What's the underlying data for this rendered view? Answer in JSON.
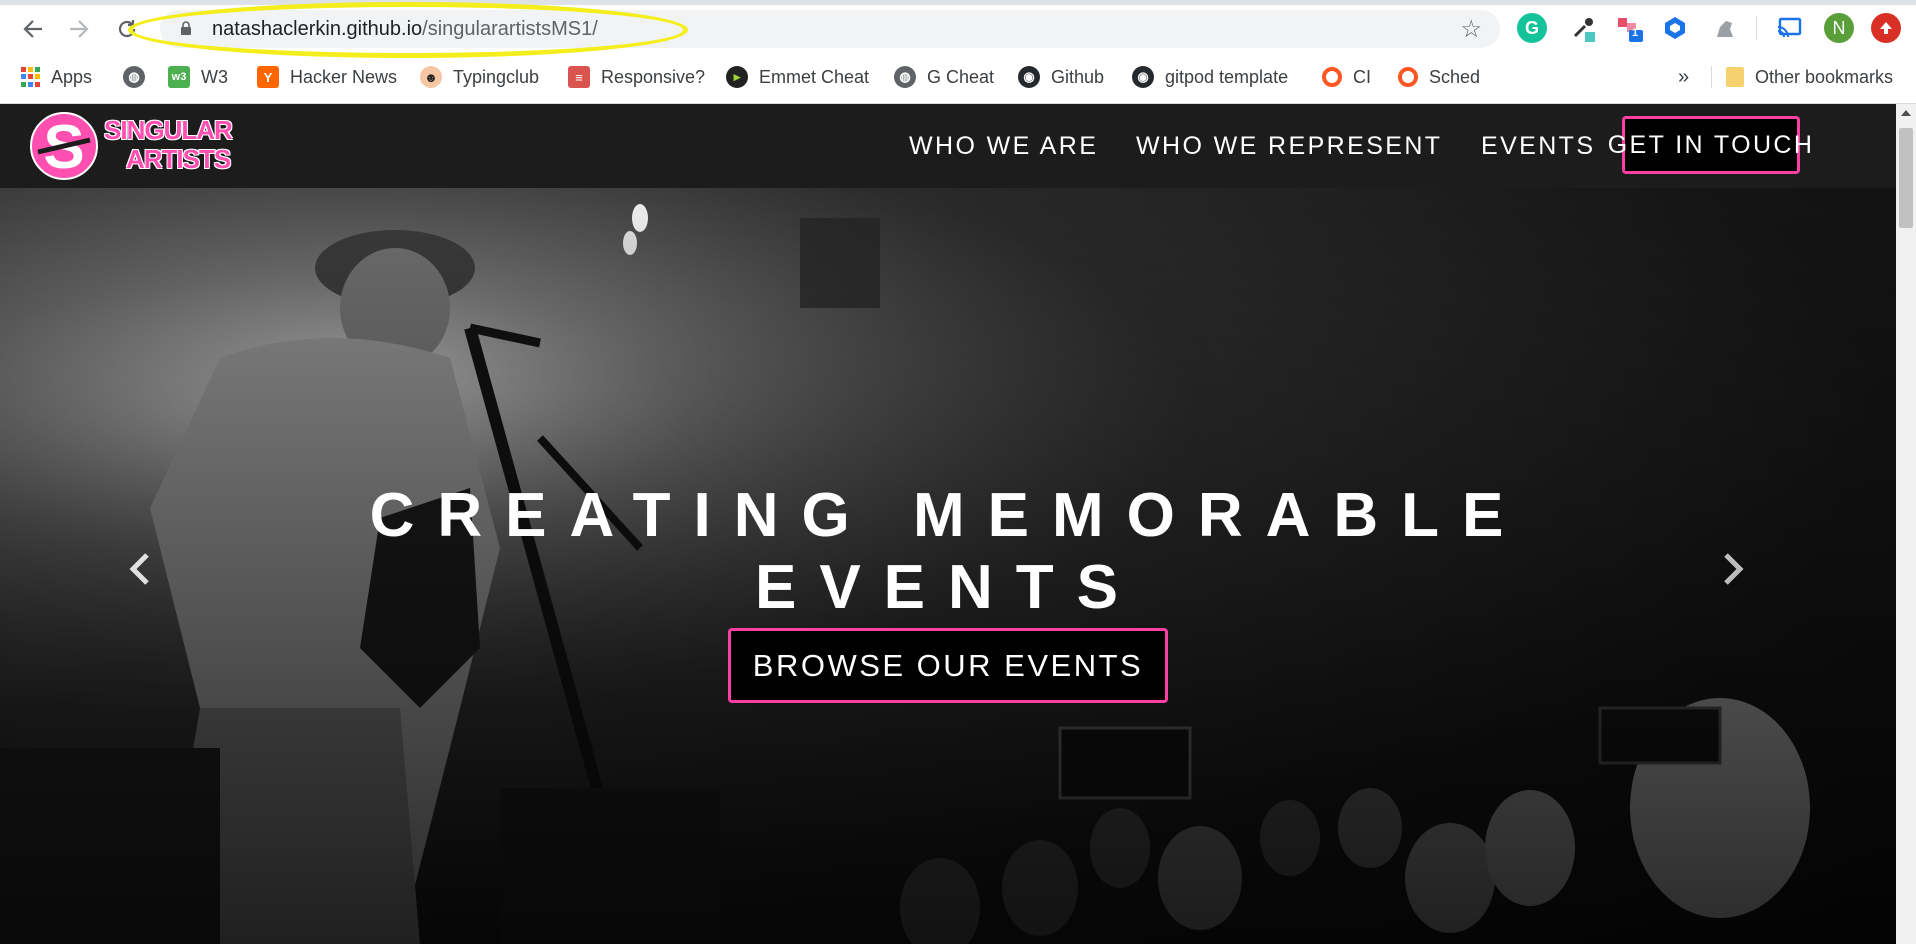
{
  "browser": {
    "url_host": "natashaclerkin.github.io",
    "url_path": "/singularartistsMS1/",
    "bookmarks": [
      {
        "label": "Apps",
        "icon": "apps-grid-icon"
      },
      {
        "label": "",
        "icon": "globe-icon"
      },
      {
        "label": "W3",
        "icon": "w3-icon"
      },
      {
        "label": "Hacker News",
        "icon": "hacker-news-icon"
      },
      {
        "label": "Typingclub",
        "icon": "typingclub-icon"
      },
      {
        "label": "Responsive?",
        "icon": "responsive-icon"
      },
      {
        "label": "Emmet Cheat",
        "icon": "emmet-icon"
      },
      {
        "label": "G Cheat",
        "icon": "globe-icon"
      },
      {
        "label": "Github",
        "icon": "github-icon"
      },
      {
        "label": "gitpod template",
        "icon": "github-icon"
      },
      {
        "label": "CI",
        "icon": "ci-icon"
      },
      {
        "label": "Sched",
        "icon": "sched-icon"
      }
    ],
    "overflow": "»",
    "other_bookmarks": "Other bookmarks",
    "profile_initial": "N",
    "badge_count": "1"
  },
  "site": {
    "logo_line1": "SINGULAR",
    "logo_line2": "ARTISTS",
    "nav": {
      "who_we_are": "WHO WE ARE",
      "who_we_represent": "WHO WE REPRESENT",
      "events": "EVENTS",
      "get_in_touch": "GET IN TOUCH"
    },
    "hero": {
      "title_line1": "CREATING MEMORABLE",
      "title_line2": "EVENTS",
      "cta": "BROWSE OUR EVENTS",
      "prev": "‹",
      "next": "›"
    },
    "colors": {
      "accent": "#ff3fa4",
      "nav_bg": "#1c1c1c"
    }
  }
}
